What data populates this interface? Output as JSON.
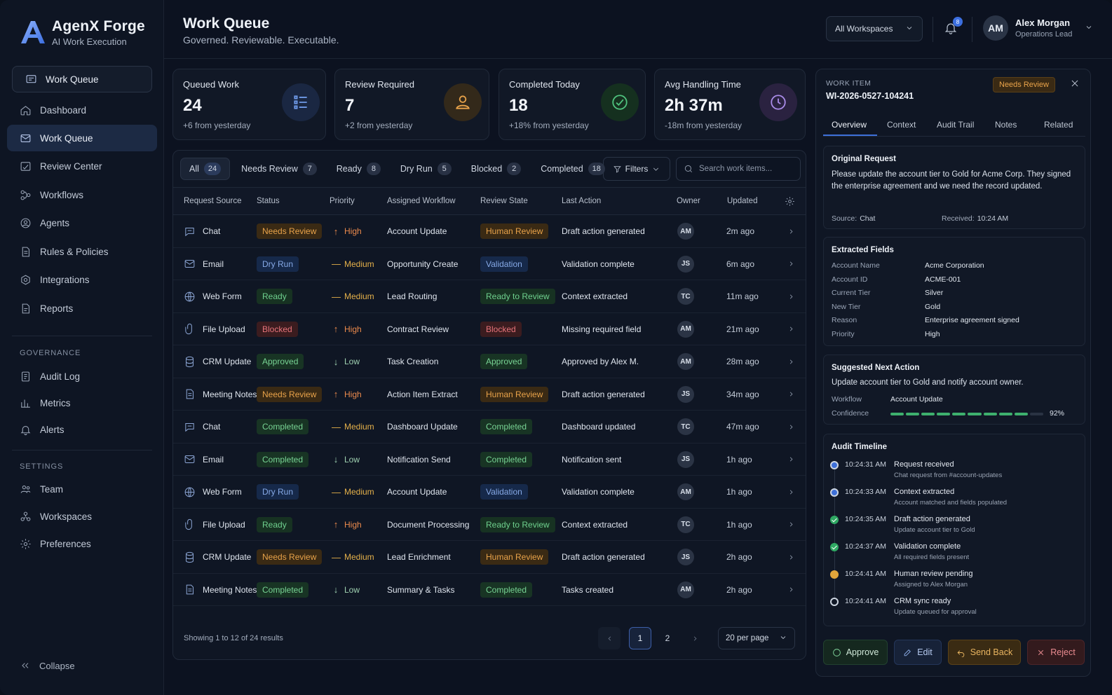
{
  "brand": {
    "name": "AgenX Forge",
    "sub": "AI Work Execution"
  },
  "sidebar": {
    "pinned": {
      "label": "Work Queue",
      "icon": "message-square-icon"
    },
    "main": [
      {
        "label": "Dashboard",
        "icon": "home-icon"
      },
      {
        "label": "Work Queue",
        "icon": "mail-icon",
        "active": true
      },
      {
        "label": "Review Center",
        "icon": "review-icon"
      },
      {
        "label": "Workflows",
        "icon": "workflow-icon"
      },
      {
        "label": "Agents",
        "icon": "agent-icon"
      },
      {
        "label": "Rules & Policies",
        "icon": "document-icon"
      },
      {
        "label": "Integrations",
        "icon": "integrations-icon"
      },
      {
        "label": "Reports",
        "icon": "reports-icon"
      }
    ],
    "governance_title": "GOVERNANCE",
    "governance": [
      {
        "label": "Audit Log",
        "icon": "audit-log-icon"
      },
      {
        "label": "Metrics",
        "icon": "metrics-icon"
      },
      {
        "label": "Alerts",
        "icon": "bell-icon"
      }
    ],
    "settings_title": "SETTINGS",
    "settings": [
      {
        "label": "Team",
        "icon": "team-icon"
      },
      {
        "label": "Workspaces",
        "icon": "workspaces-icon"
      },
      {
        "label": "Preferences",
        "icon": "gear-icon"
      }
    ],
    "collapse": "Collapse"
  },
  "header": {
    "title": "Work Queue",
    "subtitle": "Governed. Reviewable. Executable.",
    "workspace": "All Workspaces",
    "notifications": "8",
    "user": {
      "initials": "AM",
      "name": "Alex Morgan",
      "role": "Operations Lead"
    }
  },
  "stats": [
    {
      "title": "Queued Work",
      "value": "24",
      "sub": "+6 from yesterday",
      "icon": "list-icon",
      "color": "#6f9ae8"
    },
    {
      "title": "Review Required",
      "value": "7",
      "sub": "+2 from yesterday",
      "icon": "person-icon",
      "color": "#e9a34a"
    },
    {
      "title": "Completed Today",
      "value": "18",
      "sub": "+18% from yesterday",
      "icon": "check-circle-icon",
      "color": "#4fc27e"
    },
    {
      "title": "Avg Handling Time",
      "value": "2h 37m",
      "sub": "-18m from yesterday",
      "icon": "clock-icon",
      "color": "#a98be8"
    }
  ],
  "filters": {
    "tabs": [
      {
        "label": "All",
        "count": "24"
      },
      {
        "label": "Needs Review",
        "count": "7"
      },
      {
        "label": "Ready",
        "count": "8"
      },
      {
        "label": "Dry Run",
        "count": "5"
      },
      {
        "label": "Blocked",
        "count": "2"
      },
      {
        "label": "Completed",
        "count": "18"
      }
    ],
    "filters_label": "Filters",
    "search_placeholder": "Search work items..."
  },
  "table": {
    "columns": [
      "Request Source",
      "Status",
      "Priority",
      "Assigned Workflow",
      "Review State",
      "Last Action",
      "Owner",
      "Updated"
    ],
    "rows": [
      {
        "source": "Chat",
        "icon": "chat-icon",
        "status": "Needs Review",
        "priority": "High",
        "workflow": "Account Update",
        "review": "Human Review",
        "action": "Draft action generated",
        "owner": "AM",
        "updated": "2m ago"
      },
      {
        "source": "Email",
        "icon": "mail-icon",
        "status": "Dry Run",
        "priority": "Medium",
        "workflow": "Opportunity Create",
        "review": "Validation",
        "action": "Validation complete",
        "owner": "JS",
        "updated": "6m ago"
      },
      {
        "source": "Web Form",
        "icon": "globe-icon",
        "status": "Ready",
        "priority": "Medium",
        "workflow": "Lead Routing",
        "review": "Ready to Review",
        "action": "Context extracted",
        "owner": "TC",
        "updated": "11m ago"
      },
      {
        "source": "File Upload",
        "icon": "paperclip-icon",
        "status": "Blocked",
        "priority": "High",
        "workflow": "Contract Review",
        "review": "Blocked",
        "action": "Missing required field",
        "owner": "AM",
        "updated": "21m ago"
      },
      {
        "source": "CRM Update",
        "icon": "database-icon",
        "status": "Approved",
        "priority": "Low",
        "workflow": "Task Creation",
        "review": "Approved",
        "action": "Approved by Alex M.",
        "owner": "AM",
        "updated": "28m ago"
      },
      {
        "source": "Meeting Notes",
        "icon": "document-icon",
        "status": "Needs Review",
        "priority": "High",
        "workflow": "Action Item Extract",
        "review": "Human Review",
        "action": "Draft action generated",
        "owner": "JS",
        "updated": "34m ago"
      },
      {
        "source": "Chat",
        "icon": "chat-icon",
        "status": "Completed",
        "priority": "Medium",
        "workflow": "Dashboard Update",
        "review": "Completed",
        "action": "Dashboard updated",
        "owner": "TC",
        "updated": "47m ago"
      },
      {
        "source": "Email",
        "icon": "mail-icon",
        "status": "Completed",
        "priority": "Low",
        "workflow": "Notification Send",
        "review": "Completed",
        "action": "Notification sent",
        "owner": "JS",
        "updated": "1h ago"
      },
      {
        "source": "Web Form",
        "icon": "globe-icon",
        "status": "Dry Run",
        "priority": "Medium",
        "workflow": "Account Update",
        "review": "Validation",
        "action": "Validation complete",
        "owner": "AM",
        "updated": "1h ago"
      },
      {
        "source": "File Upload",
        "icon": "paperclip-icon",
        "status": "Ready",
        "priority": "High",
        "workflow": "Document Processing",
        "review": "Ready to Review",
        "action": "Context extracted",
        "owner": "TC",
        "updated": "1h ago"
      },
      {
        "source": "CRM Update",
        "icon": "database-icon",
        "status": "Needs Review",
        "priority": "Medium",
        "workflow": "Lead Enrichment",
        "review": "Human Review",
        "action": "Draft action generated",
        "owner": "JS",
        "updated": "2h ago"
      },
      {
        "source": "Meeting Notes",
        "icon": "document-icon",
        "status": "Completed",
        "priority": "Low",
        "workflow": "Summary & Tasks",
        "review": "Completed",
        "action": "Tasks created",
        "owner": "AM",
        "updated": "2h ago"
      }
    ],
    "showing": "Showing 1 to 12 of 24 results",
    "pages": [
      "1",
      "2"
    ],
    "per_page": "20 per page"
  },
  "detail": {
    "label": "WORK ITEM",
    "id": "WI-2026-0527-104241",
    "status": "Needs Review",
    "tabs": [
      "Overview",
      "Context",
      "Audit Trail",
      "Notes",
      "Related"
    ],
    "request": {
      "title": "Original Request",
      "text": "Please update the account tier to Gold for Acme Corp. They signed the enterprise agreement and we need the record updated.",
      "source_label": "Source:",
      "source": "Chat",
      "received_label": "Received:",
      "received": "10:24 AM"
    },
    "fields_title": "Extracted Fields",
    "fields": [
      {
        "k": "Account Name",
        "v": "Acme Corporation"
      },
      {
        "k": "Account ID",
        "v": "ACME-001"
      },
      {
        "k": "Current Tier",
        "v": "Silver"
      },
      {
        "k": "New Tier",
        "v": "Gold"
      },
      {
        "k": "Reason",
        "v": "Enterprise agreement signed"
      },
      {
        "k": "Priority",
        "v": "High"
      }
    ],
    "next": {
      "title": "Suggested Next Action",
      "text": "Update account tier to Gold and notify account owner.",
      "workflow_label": "Workflow",
      "workflow": "Account Update",
      "confidence_label": "Confidence",
      "confidence": "92%",
      "confidence_value": 0.92
    },
    "timeline_title": "Audit Timeline",
    "timeline": [
      {
        "time": "10:24:31 AM",
        "title": "Request received",
        "sub": "Chat request from #account-updates",
        "state": "blue"
      },
      {
        "time": "10:24:33 AM",
        "title": "Context extracted",
        "sub": "Account matched and fields populated",
        "state": "blue"
      },
      {
        "time": "10:24:35 AM",
        "title": "Draft action generated",
        "sub": "Update account tier to Gold",
        "state": "green"
      },
      {
        "time": "10:24:37 AM",
        "title": "Validation complete",
        "sub": "All required fields present",
        "state": "green"
      },
      {
        "time": "10:24:41 AM",
        "title": "Human review pending",
        "sub": "Assigned to Alex Morgan",
        "state": "amber"
      },
      {
        "time": "10:24:41 AM",
        "title": "CRM sync ready",
        "sub": "Update queued for approval",
        "state": "empty"
      }
    ],
    "actions": {
      "approve": "Approve",
      "edit": "Edit",
      "send_back": "Send Back",
      "reject": "Reject"
    }
  }
}
